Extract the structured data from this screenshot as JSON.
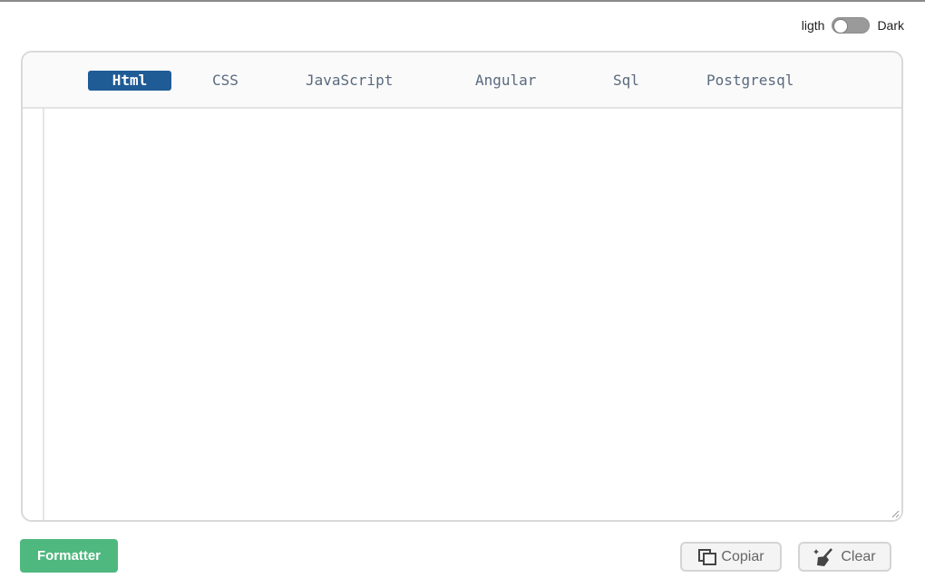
{
  "theme": {
    "light_label": "ligth",
    "dark_label": "Dark",
    "mode": "light"
  },
  "tabs": [
    {
      "label": "Html",
      "active": true
    },
    {
      "label": "CSS",
      "active": false
    },
    {
      "label": "JavaScript",
      "active": false
    },
    {
      "label": "Angular",
      "active": false
    },
    {
      "label": "Sql",
      "active": false
    },
    {
      "label": "Postgresql",
      "active": false
    }
  ],
  "editor": {
    "value": ""
  },
  "actions": {
    "formatter_label": "Formatter",
    "copy_label": "Copiar",
    "clear_label": "Clear"
  },
  "icons": {
    "copy": "copy-icon",
    "clear": "broom-icon",
    "resize": "resize-handle-icon"
  },
  "colors": {
    "active_tab": "#1f5b95",
    "formatter": "#4fb87f",
    "tab_text": "#5a6a7e"
  }
}
